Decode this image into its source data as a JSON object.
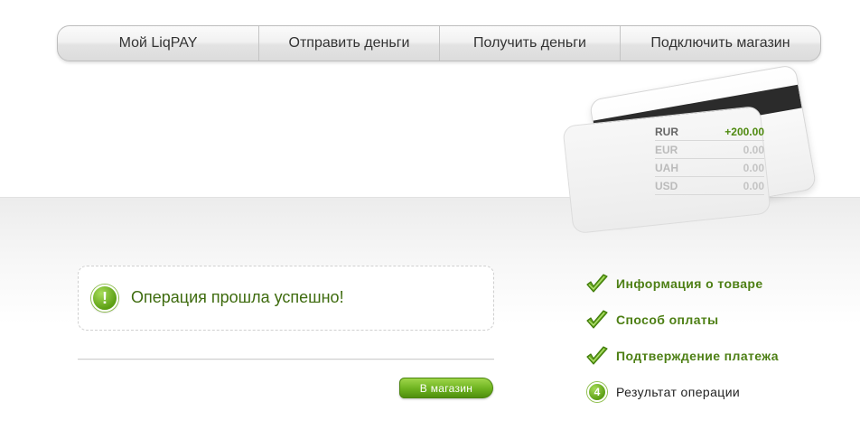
{
  "nav": {
    "items": [
      {
        "label": "Мой LiqPAY"
      },
      {
        "label": "Отправить деньги"
      },
      {
        "label": "Получить деньги"
      },
      {
        "label": "Подключить магазин"
      }
    ]
  },
  "wallet": {
    "balances": [
      {
        "currency": "RUR",
        "amount": "+200.00"
      },
      {
        "currency": "EUR",
        "amount": "0.00"
      },
      {
        "currency": "UAH",
        "amount": "0.00"
      },
      {
        "currency": "USD",
        "amount": "0.00"
      }
    ]
  },
  "message": {
    "icon": "exclamation-icon",
    "text": "Операция прошла успешно!"
  },
  "shop_button": {
    "label": "В магазин"
  },
  "steps": [
    {
      "label": "Информация о товаре",
      "status": "done",
      "icon": "checkmark-icon"
    },
    {
      "label": "Способ оплаты",
      "status": "done",
      "icon": "checkmark-icon"
    },
    {
      "label": "Подтверждение платежа",
      "status": "done",
      "icon": "checkmark-icon"
    },
    {
      "label": "Результат операции",
      "status": "current",
      "number": "4"
    }
  ],
  "colors": {
    "accent_green": "#5c9f14",
    "text_green": "#4d7f14",
    "positive_amount": "#4f8a10"
  }
}
